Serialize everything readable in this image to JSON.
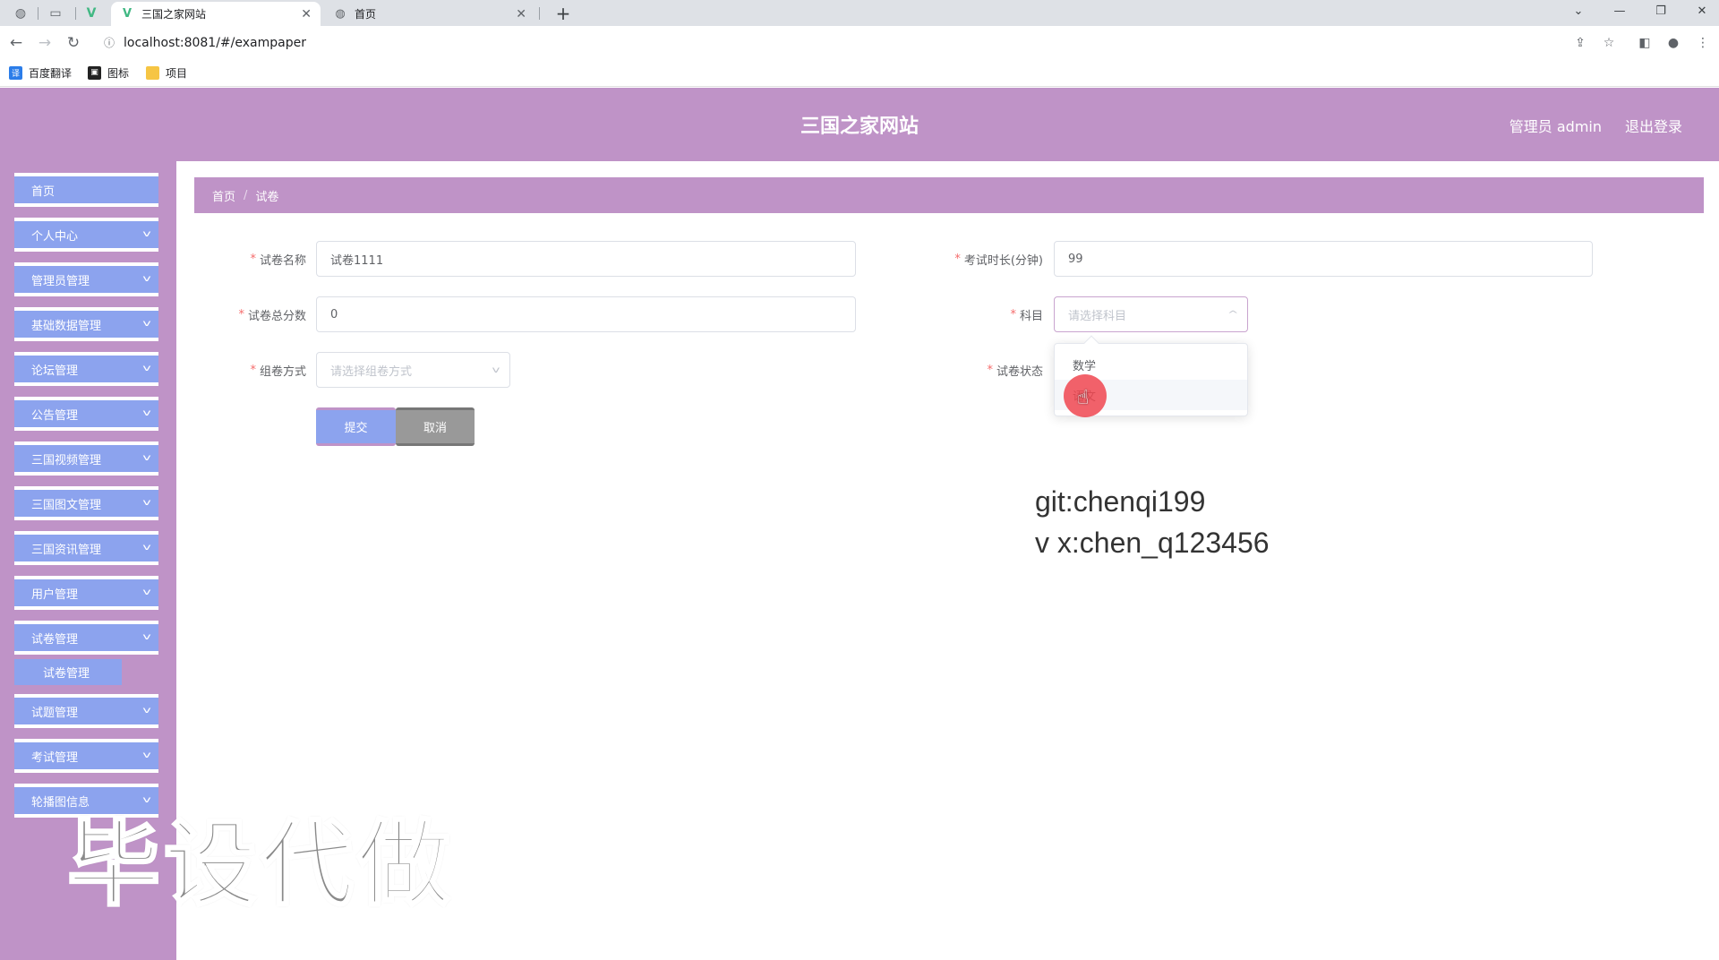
{
  "browser": {
    "tabs": [
      {
        "title": "三国之家网站",
        "active": true
      },
      {
        "title": "首页",
        "active": false
      }
    ],
    "url": "localhost:8081/#/exampaper",
    "bookmarks": [
      "百度翻译",
      "图标",
      "项目"
    ]
  },
  "header": {
    "site_title": "三国之家网站",
    "admin_label": "管理员 admin",
    "logout_label": "退出登录"
  },
  "sidebar": {
    "items": [
      {
        "label": "首页"
      },
      {
        "label": "个人中心"
      },
      {
        "label": "管理员管理"
      },
      {
        "label": "基础数据管理"
      },
      {
        "label": "论坛管理"
      },
      {
        "label": "公告管理"
      },
      {
        "label": "三国视频管理"
      },
      {
        "label": "三国图文管理"
      },
      {
        "label": "三国资讯管理"
      },
      {
        "label": "用户管理"
      },
      {
        "label": "试卷管理"
      },
      {
        "label": "试题管理"
      },
      {
        "label": "考试管理"
      },
      {
        "label": "轮播图信息"
      }
    ],
    "sub_item": "试卷管理"
  },
  "breadcrumb": {
    "home": "首页",
    "current": "试卷"
  },
  "form": {
    "paper_name": {
      "label": "试卷名称",
      "value": "试卷1111"
    },
    "duration": {
      "label": "考试时长(分钟)",
      "value": "99"
    },
    "total_score": {
      "label": "试卷总分数",
      "value": "0"
    },
    "subject": {
      "label": "科目",
      "placeholder": "请选择科目",
      "options": [
        "数学",
        "语文"
      ]
    },
    "compose_method": {
      "label": "组卷方式",
      "placeholder": "请选择组卷方式"
    },
    "status": {
      "label": "试卷状态"
    },
    "submit_label": "提交",
    "cancel_label": "取消"
  },
  "overlay": {
    "git": "git:chenqi199",
    "vx": "v x:chen_q123456",
    "big": "毕设代做"
  }
}
